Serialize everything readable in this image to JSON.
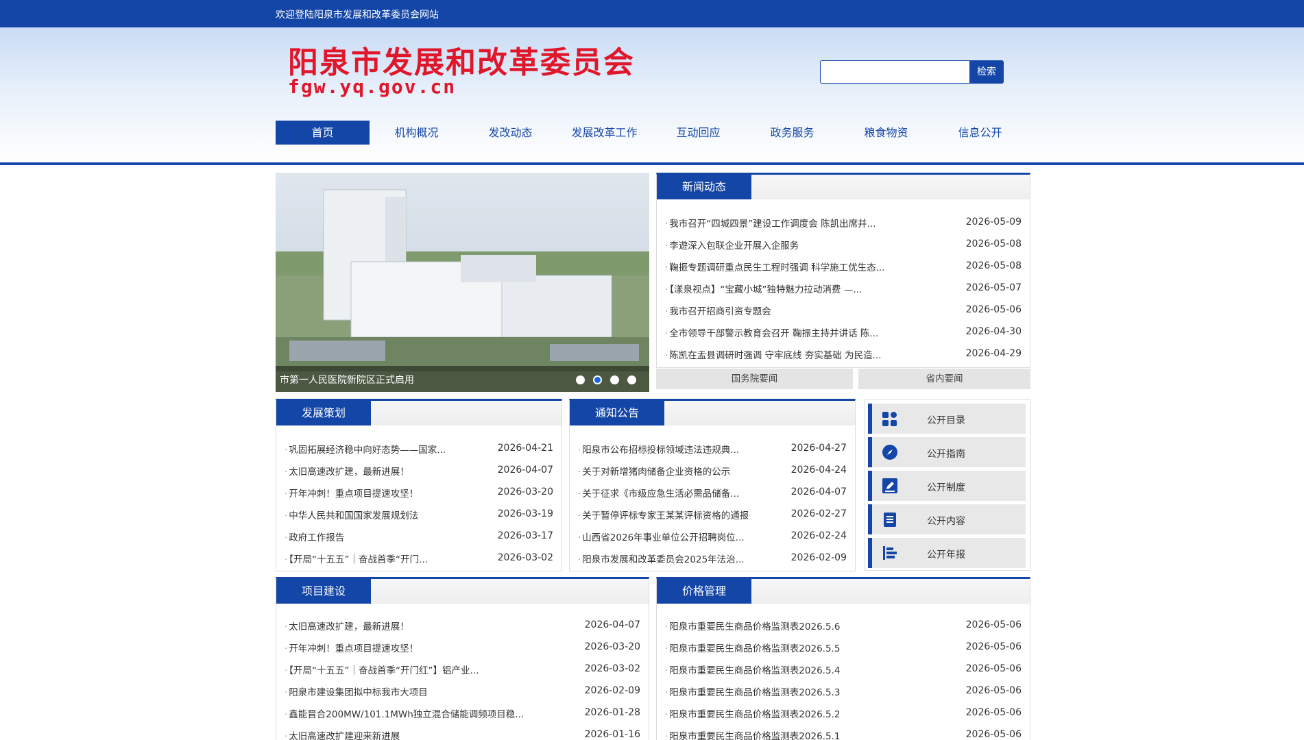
{
  "topbar": {
    "welcome": "欢迎登陆阳泉市发展和改革委员会网站"
  },
  "header": {
    "site_name": "阳泉市发展和改革委员会",
    "site_domain": "fgw.yq.gov.cn"
  },
  "search": {
    "placeholder": "",
    "button_label": "检索"
  },
  "nav": [
    "首页",
    "机构概况",
    "发改动态",
    "发展改革工作",
    "互动回应",
    "政务服务",
    "粮食物资",
    "信息公开"
  ],
  "slider": {
    "caption": "市第一人民医院新院区正式启用",
    "dot_count": 4,
    "active_dot": 2
  },
  "news": {
    "title": "新闻动态",
    "items": [
      {
        "text": "我市召开“四城四景”建设工作调度会 陈凯出席并...",
        "date": "2026-05-09"
      },
      {
        "text": "李遊深入包联企业开展入企服务",
        "date": "2026-05-08"
      },
      {
        "text": "鞠振专题调研重点民生工程时强调 科学施工优生态...",
        "date": "2026-05-08"
      },
      {
        "text": "【漾泉视点】“宝藏小城”独特魅力拉动消费 —...",
        "date": "2026-05-07"
      },
      {
        "text": "我市召开招商引资专题会",
        "date": "2026-05-06"
      },
      {
        "text": "全市领导干部警示教育会召开 鞠振主持并讲话 陈...",
        "date": "2026-04-30"
      },
      {
        "text": "陈凯在盂县调研时强调 守牢底线 夯实基础 为民造...",
        "date": "2026-04-29"
      }
    ],
    "tabs": [
      "国务院要闻",
      "省内要闻"
    ]
  },
  "planning": {
    "title": "发展策划",
    "items": [
      {
        "text": "巩固拓展经济稳中向好态势——国家...",
        "date": "2026-04-21"
      },
      {
        "text": "太旧高速改扩建，最新进展！",
        "date": "2026-04-07"
      },
      {
        "text": "开年冲刺！重点项目提速攻坚！",
        "date": "2026-03-20"
      },
      {
        "text": "中华人民共和国国家发展规划法",
        "date": "2026-03-19"
      },
      {
        "text": "政府工作报告",
        "date": "2026-03-17"
      },
      {
        "text": "【开局“十五五”｜奋战首季“开门...",
        "date": "2026-03-02"
      }
    ]
  },
  "notice": {
    "title": "通知公告",
    "items": [
      {
        "text": "阳泉市公布招标投标领域违法违规典...",
        "date": "2026-04-27"
      },
      {
        "text": "关于对新增猪肉储备企业资格的公示",
        "date": "2026-04-24"
      },
      {
        "text": "关于征求《市级应急生活必需品储备...",
        "date": "2026-04-07"
      },
      {
        "text": "关于暂停评标专家王某某评标资格的通报",
        "date": "2026-02-27"
      },
      {
        "text": "山西省2026年事业单位公开招聘岗位...",
        "date": "2026-02-24"
      },
      {
        "text": "阳泉市发展和改革委员会2025年法治...",
        "date": "2026-02-09"
      }
    ]
  },
  "open_list": [
    {
      "label": "公开目录",
      "icon": "directory-icon"
    },
    {
      "label": "公开指南",
      "icon": "compass-icon"
    },
    {
      "label": "公开制度",
      "icon": "edit-icon"
    },
    {
      "label": "公开内容",
      "icon": "document-icon"
    },
    {
      "label": "公开年报",
      "icon": "report-icon"
    }
  ],
  "projects": {
    "title": "项目建设",
    "items": [
      {
        "text": "太旧高速改扩建，最新进展！",
        "date": "2026-04-07"
      },
      {
        "text": "开年冲刺！重点项目提速攻坚！",
        "date": "2026-03-20"
      },
      {
        "text": "【开局“十五五”｜奋战首季“开门红”】铝产业...",
        "date": "2026-03-02"
      },
      {
        "text": "阳泉市建设集团拟中标我市大项目",
        "date": "2026-02-09"
      },
      {
        "text": "鑫能晋合200MW/101.1MWh独立混合储能调频项目稳...",
        "date": "2026-01-28"
      },
      {
        "text": "太旧高速改扩建迎来新进展",
        "date": "2026-01-16"
      }
    ]
  },
  "prices": {
    "title": "价格管理",
    "items": [
      {
        "text": "阳泉市重要民生商品价格监测表2026.5.6",
        "date": "2026-05-06"
      },
      {
        "text": "阳泉市重要民生商品价格监测表2026.5.5",
        "date": "2026-05-06"
      },
      {
        "text": "阳泉市重要民生商品价格监测表2026.5.4",
        "date": "2026-05-06"
      },
      {
        "text": "阳泉市重要民生商品价格监测表2026.5.3",
        "date": "2026-05-06"
      },
      {
        "text": "阳泉市重要民生商品价格监测表2026.5.2",
        "date": "2026-05-06"
      },
      {
        "text": "阳泉市重要民生商品价格监测表2026.5.1",
        "date": "2026-05-06"
      }
    ]
  }
}
